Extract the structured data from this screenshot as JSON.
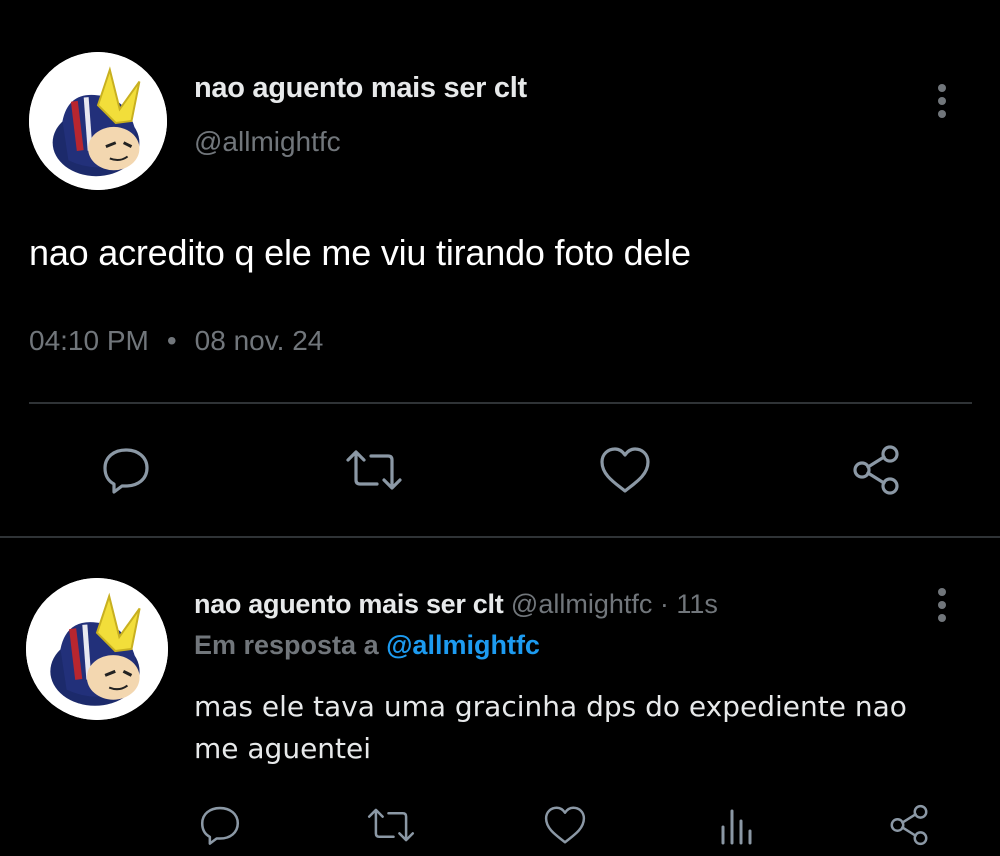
{
  "tweet": {
    "display_name": "nao aguento mais ser clt",
    "handle": "@allmightfc",
    "text": "nao acredito q ele me viu tirando foto dele",
    "time": "04:10 PM",
    "separator": "•",
    "date": "08 nov. 24",
    "actions": [
      "reply-icon",
      "retweet-icon",
      "like-icon",
      "share-icon"
    ]
  },
  "reply": {
    "display_name": "nao aguento mais ser clt",
    "handle": "@allmightfc",
    "separator": "·",
    "time": "11s",
    "reply_to_label": "Em resposta a",
    "reply_to_handle": "@allmightfc",
    "text": "mas ele tava uma gracinha dps do expediente nao me aguentei",
    "actions": [
      "reply-icon",
      "retweet-icon",
      "like-icon",
      "views-icon",
      "share-icon"
    ]
  },
  "colors": {
    "background": "#000000",
    "text": "#e7e9ea",
    "secondary": "#71767b",
    "link": "#1d9bf0",
    "divider": "#2f3336"
  }
}
